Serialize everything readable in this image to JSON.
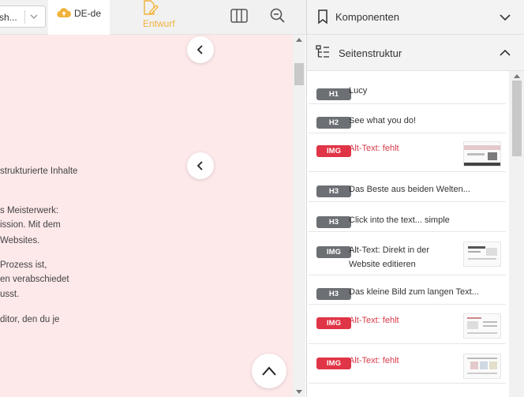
{
  "toolbar": {
    "page_select": {
      "value": "sh..."
    },
    "language_tab": {
      "label": "DE-de"
    },
    "draft_button": {
      "label": "Entwurf"
    },
    "icons": [
      "chevron-down-icon",
      "cloud-upload-icon",
      "edit-icon",
      "columns-icon",
      "zoom-out-icon"
    ]
  },
  "content": {
    "background_color": "#fde8ea",
    "paragraphs": [
      [
        "strukturierte Inhalte"
      ],
      [
        "s Meisterwerk:",
        "ission. Mit dem",
        " Websites."
      ],
      [
        " Prozess ist,",
        "en verabschiedet",
        "usst."
      ],
      [
        "ditor, den du je"
      ]
    ]
  },
  "panel": {
    "components": {
      "title": "Komponenten"
    },
    "structure": {
      "title": "Seitenstruktur"
    },
    "items": [
      {
        "tag": "H1",
        "label": "Lucy",
        "type": "heading"
      },
      {
        "tag": "H2",
        "label": "See what you do!",
        "type": "heading"
      },
      {
        "tag": "IMG",
        "label": "Alt-Text: fehlt",
        "type": "image",
        "alert": true
      },
      {
        "tag": "H3",
        "label": "Das Beste aus beiden Welten...",
        "type": "heading"
      },
      {
        "tag": "H3",
        "label": "Click into the text... simple",
        "type": "heading"
      },
      {
        "tag": "IMG",
        "label": "Alt-Text: Direkt in der Website editieren",
        "type": "image",
        "alert": false
      },
      {
        "tag": "H3",
        "label": "Das kleine Bild zum langen Text...",
        "type": "heading"
      },
      {
        "tag": "IMG",
        "label": "Alt-Text: fehlt",
        "type": "image",
        "alert": true
      },
      {
        "tag": "IMG",
        "label": "Alt-Text: fehlt",
        "type": "image",
        "alert": true
      }
    ]
  },
  "colors": {
    "accent_warning": "#f1b23c",
    "heading_tag": "#6c6f73",
    "image_tag_missing": "#e03546",
    "missing_text": "#d93a4a"
  }
}
